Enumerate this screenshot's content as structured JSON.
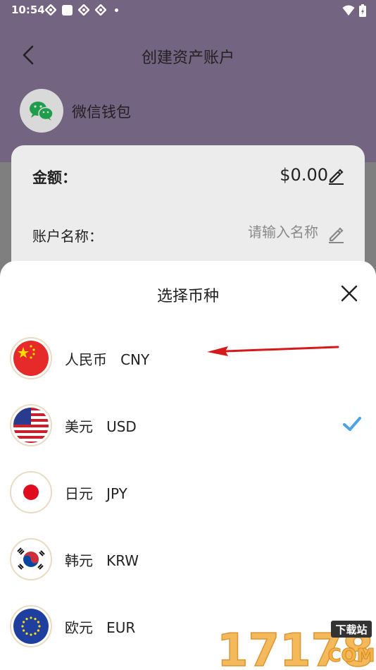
{
  "status_bar": {
    "time": "10:54"
  },
  "header": {
    "title": "创建资产账户",
    "wallet_name": "微信钱包"
  },
  "form": {
    "amount_label": "金额：",
    "amount_value": "$0.00",
    "name_label": "账户名称：",
    "name_placeholder": "请输入名称"
  },
  "sheet": {
    "title": "选择币种",
    "currencies": [
      {
        "name": "人民币",
        "code": "CNY",
        "selected": false
      },
      {
        "name": "美元",
        "code": "USD",
        "selected": true
      },
      {
        "name": "日元",
        "code": "JPY",
        "selected": false
      },
      {
        "name": "韩元",
        "code": "KRW",
        "selected": false
      },
      {
        "name": "欧元",
        "code": "EUR",
        "selected": false
      }
    ]
  },
  "watermark": {
    "text": "17178",
    "sub": "下载站",
    "domain": "COM"
  },
  "colors": {
    "header_bg": "#736482",
    "check": "#4aa3e8",
    "annotation_arrow": "#d7191c"
  }
}
